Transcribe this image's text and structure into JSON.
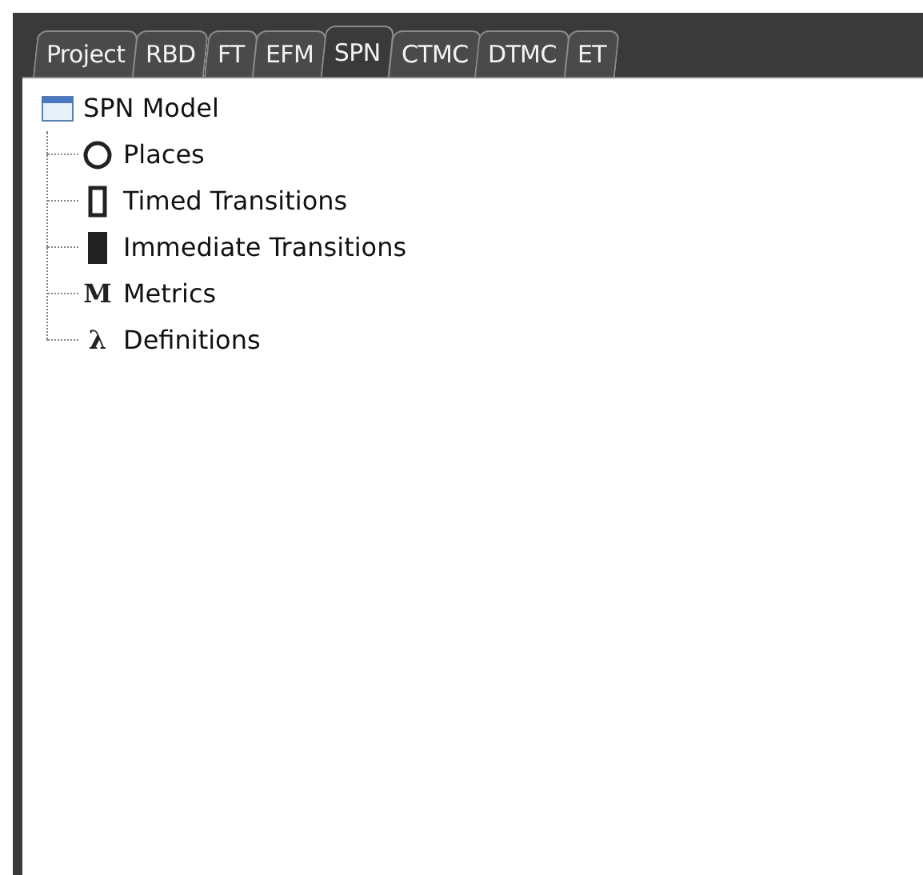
{
  "tabs": [
    {
      "label": "Project",
      "selected": false
    },
    {
      "label": "RBD",
      "selected": false
    },
    {
      "label": "FT",
      "selected": false
    },
    {
      "label": "EFM",
      "selected": false
    },
    {
      "label": "SPN",
      "selected": true
    },
    {
      "label": "CTMC",
      "selected": false
    },
    {
      "label": "DTMC",
      "selected": false
    },
    {
      "label": "ET",
      "selected": false
    }
  ],
  "tree": {
    "label": "SPN Model",
    "children": [
      {
        "label": "Places",
        "kind": "circle"
      },
      {
        "label": "Timed Transitions",
        "kind": "hollow-bar"
      },
      {
        "label": "Immediate Transitions",
        "kind": "solid-bar"
      },
      {
        "label": "Metrics",
        "kind": "glyph",
        "glyph": "M"
      },
      {
        "label": "Definitions",
        "kind": "glyph",
        "glyph": "λ"
      }
    ]
  }
}
